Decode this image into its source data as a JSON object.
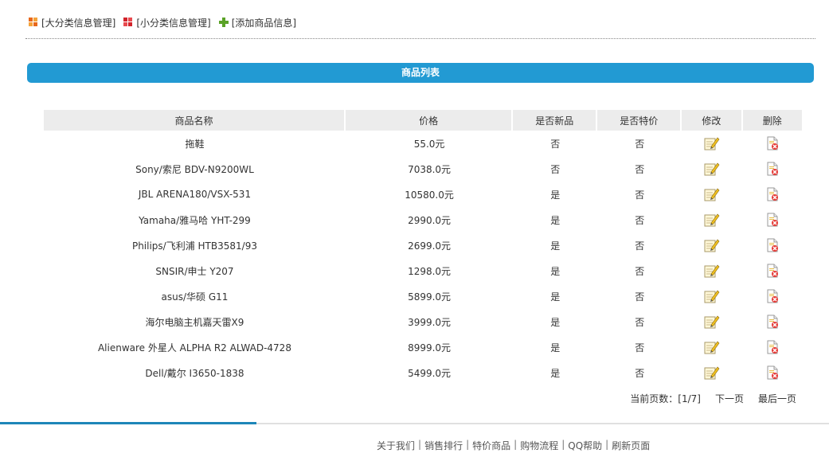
{
  "topnav": {
    "big_category": "[大分类信息管理]",
    "small_category": "[小分类信息管理]",
    "add_product": "[添加商品信息]"
  },
  "banner": {
    "title": "商品列表"
  },
  "table": {
    "headers": [
      "商品名称",
      "价格",
      "是否新品",
      "是否特价",
      "修改",
      "删除"
    ],
    "rows": [
      {
        "name": "拖鞋",
        "price": "55.0元",
        "is_new": "否",
        "is_special": "否"
      },
      {
        "name": "Sony/索尼 BDV-N9200WL",
        "price": "7038.0元",
        "is_new": "否",
        "is_special": "否"
      },
      {
        "name": "JBL ARENA180/VSX-531",
        "price": "10580.0元",
        "is_new": "是",
        "is_special": "否"
      },
      {
        "name": "Yamaha/雅马哈 YHT-299",
        "price": "2990.0元",
        "is_new": "是",
        "is_special": "否"
      },
      {
        "name": "Philips/飞利浦 HTB3581/93",
        "price": "2699.0元",
        "is_new": "是",
        "is_special": "否"
      },
      {
        "name": "SNSIR/申士 Y207",
        "price": "1298.0元",
        "is_new": "是",
        "is_special": "否"
      },
      {
        "name": "asus/华硕 G11",
        "price": "5899.0元",
        "is_new": "是",
        "is_special": "否"
      },
      {
        "name": "海尔电脑主机嘉天雷X9",
        "price": "3999.0元",
        "is_new": "是",
        "is_special": "否"
      },
      {
        "name": "Alienware 外星人 ALPHA R2 ALWAD-4728",
        "price": "8999.0元",
        "is_new": "是",
        "is_special": "否"
      },
      {
        "name": "Dell/戴尔 I3650-1838",
        "price": "5499.0元",
        "is_new": "是",
        "is_special": "否"
      }
    ]
  },
  "pager": {
    "current": "当前页数：[1/7]",
    "next": "下一页",
    "last": "最后一页"
  },
  "footer": {
    "links": [
      "关于我们",
      "销售排行",
      "特价商品",
      "购物流程",
      "QQ帮助",
      "刷新页面"
    ],
    "separator": "|"
  },
  "colors": {
    "banner": "#229ad3",
    "footer_accent": "#1d86b8",
    "header_bg": "#ececec"
  },
  "icons": {
    "big_category": "orange-grid-icon",
    "small_category": "red-grid-icon",
    "add_product": "green-plus-icon",
    "edit": "edit-note-icon",
    "delete": "delete-file-icon"
  }
}
